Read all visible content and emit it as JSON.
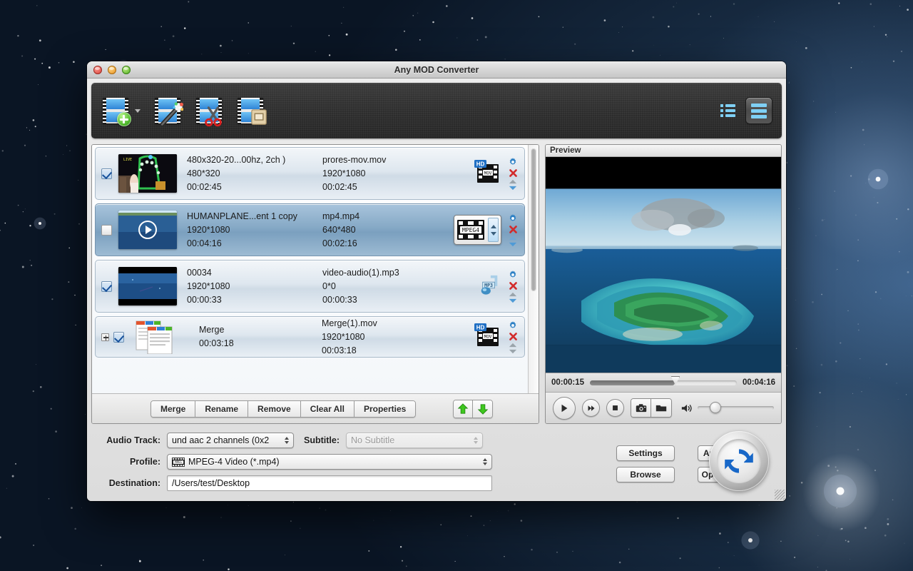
{
  "window": {
    "title": "Any MOD Converter",
    "traffic_lights": [
      "close-button",
      "minimize-button",
      "zoom-button"
    ]
  },
  "toolbar": {
    "buttons": [
      {
        "name": "add-video-button",
        "icon": "film-add-icon",
        "label": "Add Video"
      },
      {
        "name": "edit-effect-button",
        "icon": "film-wand-icon",
        "label": "Edit"
      },
      {
        "name": "clip-button",
        "icon": "film-scissors-icon",
        "label": "Clip"
      },
      {
        "name": "crop-button",
        "icon": "film-crop-icon",
        "label": "Crop"
      }
    ],
    "view_modes": [
      {
        "name": "thumbnail-view-button",
        "icon": "list-small-icon",
        "active": false
      },
      {
        "name": "detail-view-button",
        "icon": "list-large-icon",
        "active": true
      }
    ]
  },
  "file_list": {
    "rows": [
      {
        "checked": true,
        "selected": false,
        "thumbnail": "stage-live-thumb",
        "source_title": "480x320-20...00hz,  2ch )",
        "source_resolution": "480*320",
        "source_duration": "00:02:45",
        "output_name": "prores-mov.mov",
        "output_resolution": "1920*1080",
        "output_duration": "00:02:45",
        "format_icon": "hd-mov-icon",
        "format_badge": "HD",
        "format_label": "MOV",
        "has_stepper": false,
        "expandable": false
      },
      {
        "checked": false,
        "selected": true,
        "thumbnail": "ocean-play-thumb",
        "source_title": "HUMANPLANE...ent 1 copy",
        "source_resolution": "1920*1080",
        "source_duration": "00:04:16",
        "output_name": "mp4.mp4",
        "output_resolution": "640*480",
        "output_duration": "00:02:16",
        "format_icon": "mpeg4-icon",
        "format_badge": "",
        "format_label": "MPEG4",
        "has_stepper": true,
        "expandable": false
      },
      {
        "checked": true,
        "selected": false,
        "thumbnail": "blue-sky-thumb",
        "source_title": "00034",
        "source_resolution": "1920*1080",
        "source_duration": "00:00:33",
        "output_name": "video-audio(1).mp3",
        "output_resolution": "0*0",
        "output_duration": "00:00:33",
        "format_icon": "mp3-audio-icon",
        "format_badge": "",
        "format_label": "MP3",
        "has_stepper": false,
        "expandable": false
      },
      {
        "checked": true,
        "selected": false,
        "thumbnail": "merge-docs-thumb",
        "source_title": "Merge",
        "source_resolution": "",
        "source_duration": "00:03:18",
        "output_name": "Merge(1).mov",
        "output_resolution": "1920*1080",
        "output_duration": "00:03:18",
        "format_icon": "hd-mov-icon",
        "format_badge": "HD",
        "format_label": "MOV",
        "has_stepper": false,
        "expandable": true
      }
    ],
    "row_actions": [
      "settings-gear-icon",
      "remove-x-icon",
      "move-up-icon",
      "move-down-icon"
    ],
    "buttons": [
      "Merge",
      "Rename",
      "Remove",
      "Clear All",
      "Properties"
    ],
    "order_buttons": [
      {
        "name": "move-up-button",
        "icon": "green-up-arrow-icon"
      },
      {
        "name": "move-down-button",
        "icon": "green-down-arrow-icon"
      }
    ]
  },
  "preview": {
    "header": "Preview",
    "current_time": "00:00:15",
    "total_time": "00:04:16",
    "progress_percent": 58,
    "volume_percent": 23,
    "controls": [
      {
        "name": "play-button",
        "icon": "play-icon"
      },
      {
        "name": "fast-forward-button",
        "icon": "fast-forward-icon"
      },
      {
        "name": "stop-button",
        "icon": "stop-icon"
      },
      {
        "name": "snapshot-button",
        "icon": "camera-icon"
      },
      {
        "name": "open-snapshot-folder-button",
        "icon": "folder-icon"
      },
      {
        "name": "volume-button",
        "icon": "speaker-icon"
      }
    ]
  },
  "settings": {
    "audio_track_label": "Audio Track:",
    "audio_track_value": "und aac 2 channels (0x2",
    "subtitle_label": "Subtitle:",
    "subtitle_value": "No Subtitle",
    "profile_label": "Profile:",
    "profile_value": "MPEG-4 Video (*.mp4)",
    "profile_icon": "mpeg-film-icon",
    "destination_label": "Destination:",
    "destination_value": "/Users/test/Desktop",
    "buttons": {
      "settings": "Settings",
      "apply_to_all": "Apply to All",
      "browse": "Browse",
      "open_folder": "Open Folder"
    },
    "convert_button": "convert-refresh-icon"
  },
  "colors": {
    "accent_blue": "#2e84d6",
    "selection_blue": "#86a9c6",
    "green": "#4cb52a",
    "red": "#e0564c",
    "toolbar_dark": "#2e2e2e"
  }
}
